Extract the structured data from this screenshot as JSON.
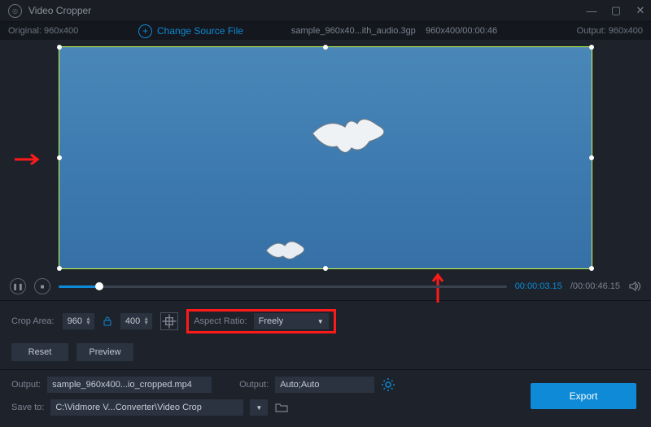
{
  "titlebar": {
    "title": "Video Cropper"
  },
  "infobar": {
    "original": "Original: 960x400",
    "change_source": "Change Source File",
    "filename": "sample_960x40...ith_audio.3gp",
    "file_meta": "960x400/00:00:46",
    "output": "Output: 960x400"
  },
  "playback": {
    "current": "00:00:03.15",
    "total": "00:00:46.15"
  },
  "crop": {
    "area_label": "Crop Area:",
    "width": "960",
    "height": "400",
    "aspect_label": "Aspect Ratio:",
    "aspect_value": "Freely"
  },
  "buttons": {
    "reset": "Reset",
    "preview": "Preview",
    "export": "Export"
  },
  "output": {
    "file_label": "Output:",
    "file_value": "sample_960x400...io_cropped.mp4",
    "size_label": "Output:",
    "size_value": "Auto;Auto"
  },
  "saveto": {
    "label": "Save to:",
    "path": "C:\\Vidmore V...Converter\\Video Crop"
  }
}
